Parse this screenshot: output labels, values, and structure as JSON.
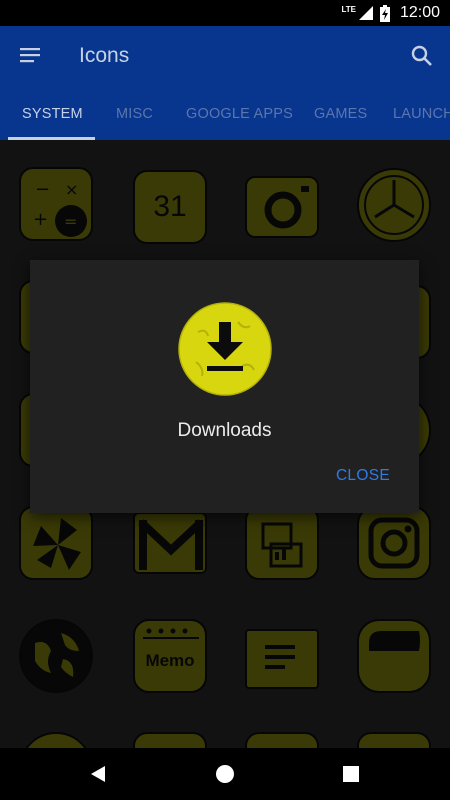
{
  "status_bar": {
    "network": "LTE",
    "time": "12:00",
    "icons": [
      "signal-icon",
      "battery-charging-icon"
    ]
  },
  "toolbar": {
    "title": "Icons",
    "icons": [
      "menu-icon",
      "search-icon"
    ]
  },
  "tabs": [
    {
      "label": "SYSTEM",
      "active": true
    },
    {
      "label": "MISC",
      "active": false
    },
    {
      "label": "GOOGLE APPS",
      "active": false
    },
    {
      "label": "GAMES",
      "active": false
    },
    {
      "label": "LAUNCH",
      "active": false
    }
  ],
  "grid_icons": [
    {
      "name": "calculator-icon"
    },
    {
      "name": "calendar-icon",
      "text": "31"
    },
    {
      "name": "camera-icon"
    },
    {
      "name": "clock-icon"
    },
    {
      "name": "contacts-icon"
    },
    {
      "name": "downloads-icon"
    },
    {
      "name": "drive-icon"
    },
    {
      "name": "files-icon"
    },
    {
      "name": "gallery-icon"
    },
    {
      "name": "files-icon"
    },
    {
      "name": "files-icon"
    },
    {
      "name": "settings-icon"
    },
    {
      "name": "pinwheel-icon"
    },
    {
      "name": "gmail-icon"
    },
    {
      "name": "keyboard-icon"
    },
    {
      "name": "instagram-icon"
    },
    {
      "name": "globe-icon"
    },
    {
      "name": "memo-icon",
      "text": "Memo"
    },
    {
      "name": "messages-icon"
    },
    {
      "name": "notes-icon"
    }
  ],
  "dialog": {
    "label": "Downloads",
    "close_label": "CLOSE",
    "icon": "downloads-icon"
  },
  "nav_bar": {
    "icons": [
      "back-icon",
      "home-icon",
      "recents-icon"
    ]
  },
  "colors": {
    "primary": "#08368f",
    "accent": "#2f7be8",
    "icon_fill": "#5a5a0a",
    "dialog_icon_fill": "#d8d60e",
    "background": "#1c1c1c"
  }
}
